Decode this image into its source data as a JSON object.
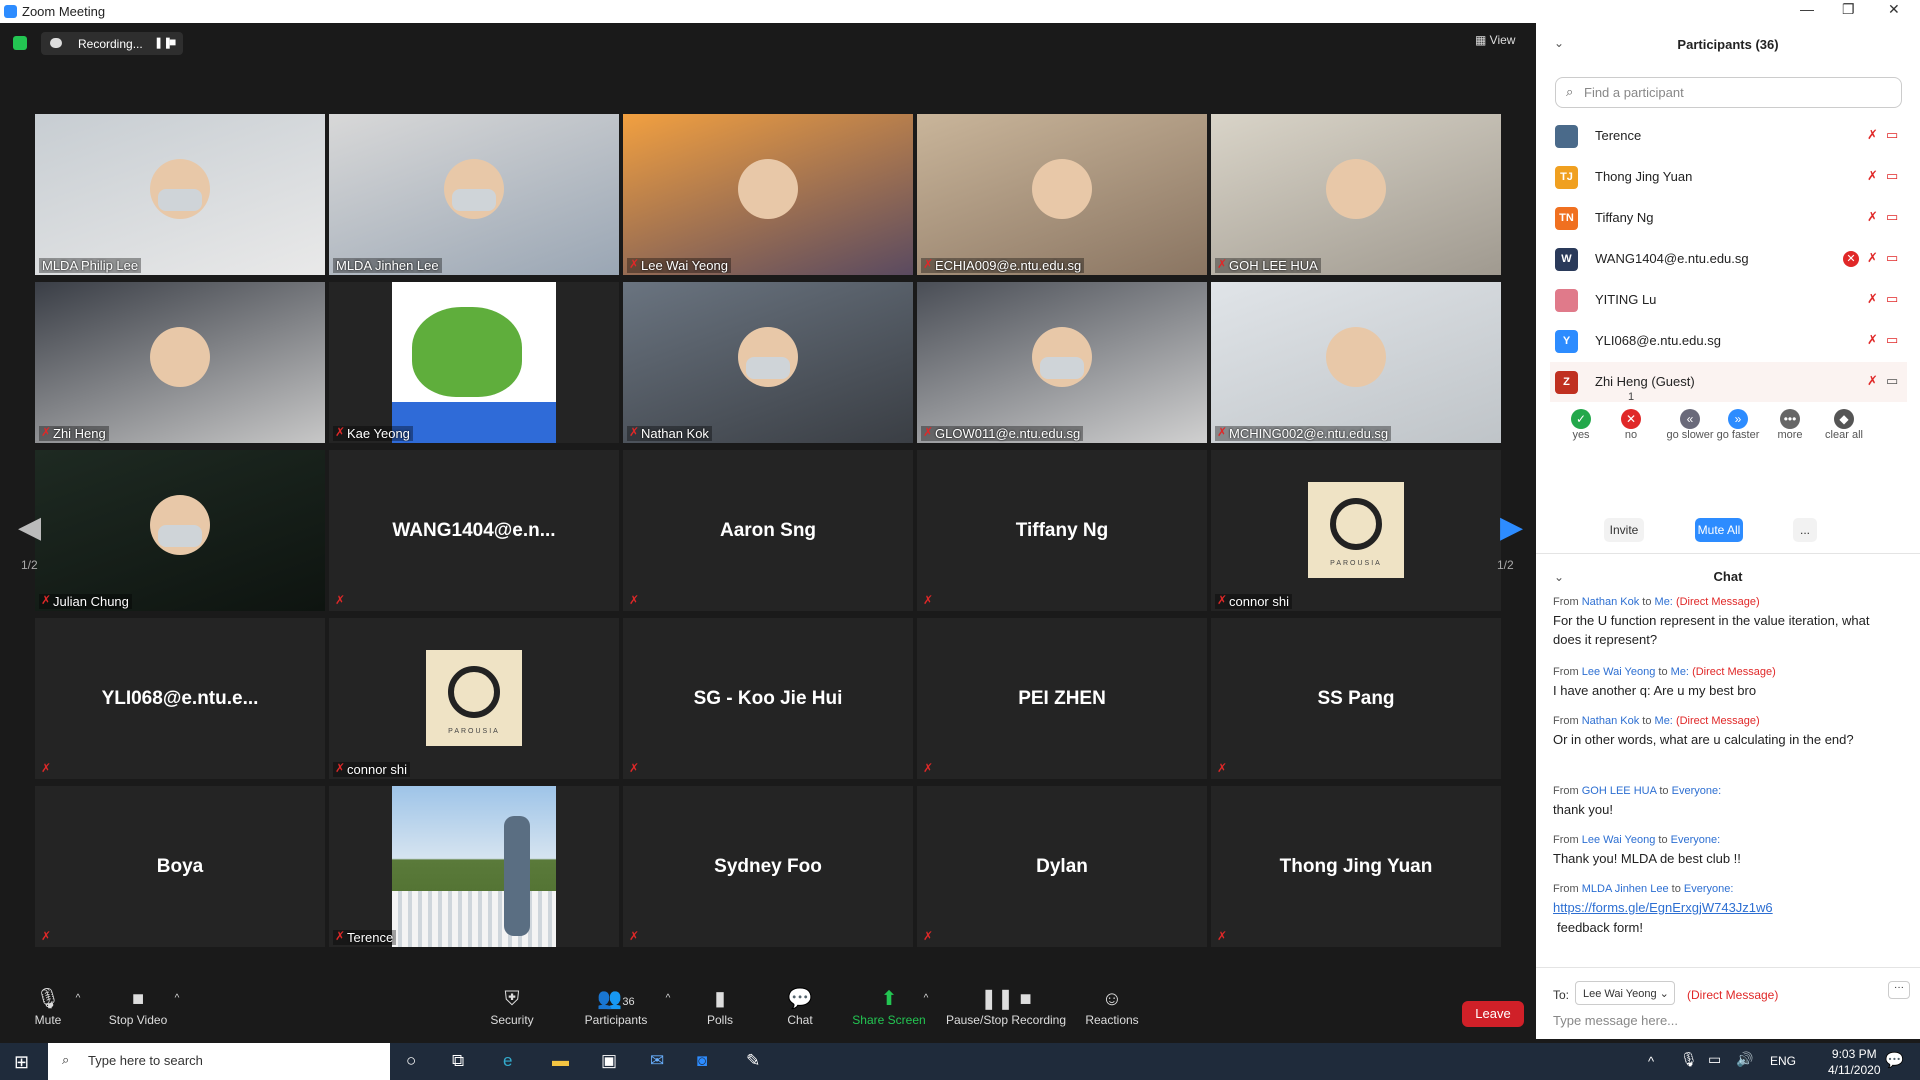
{
  "window": {
    "title": "Zoom Meeting"
  },
  "topbar": {
    "recording": "Recording...",
    "view": "View"
  },
  "page": {
    "left": "1/2",
    "right": "1/2"
  },
  "tiles": [
    {
      "name": "MLDA Philip Lee",
      "video": true
    },
    {
      "name": "MLDA Jinhen Lee",
      "video": true,
      "active": true
    },
    {
      "name": "Lee Wai Yeong",
      "video": true
    },
    {
      "name": "ECHIA009@e.ntu.edu.sg",
      "video": true
    },
    {
      "name": "GOH LEE HUA",
      "video": true
    },
    {
      "name": "Zhi Heng",
      "video": true
    },
    {
      "name": "Kae Yeong",
      "video": true
    },
    {
      "name": "Nathan Kok",
      "video": true
    },
    {
      "name": "GLOW011@e.ntu.edu.sg",
      "video": true
    },
    {
      "name": "MCHING002@e.ntu.edu.sg",
      "video": true
    },
    {
      "name": "Julian Chung",
      "video": true
    },
    {
      "name": "WANG1404@e.n...",
      "video": false
    },
    {
      "name": "Aaron Sng",
      "video": false
    },
    {
      "name": "Tiffany Ng",
      "video": false
    },
    {
      "name": "connor shi",
      "video": false,
      "logo": true
    },
    {
      "name": "YLI068@e.ntu.e...",
      "video": false
    },
    {
      "name": "connor shi",
      "video": false,
      "logo": true
    },
    {
      "name": "SG - Koo Jie Hui",
      "video": false
    },
    {
      "name": "PEI ZHEN",
      "video": false
    },
    {
      "name": "SS Pang",
      "video": false
    },
    {
      "name": "Boya",
      "video": false
    },
    {
      "name": "Terence",
      "video": true
    },
    {
      "name": "Sydney Foo",
      "video": false
    },
    {
      "name": "Dylan",
      "video": false
    },
    {
      "name": "Thong Jing Yuan",
      "video": false
    }
  ],
  "logo_text": "PAROUSIA",
  "toolbar": {
    "mute": "Mute",
    "stop_video": "Stop Video",
    "security": "Security",
    "participants": "Participants",
    "participants_count": "36",
    "polls": "Polls",
    "chat": "Chat",
    "share_screen": "Share Screen",
    "pause_stop_recording": "Pause/Stop Recording",
    "reactions": "Reactions",
    "leave": "Leave"
  },
  "participants": {
    "title": "Participants (36)",
    "search_placeholder": "Find a participant",
    "list": [
      {
        "name": "Terence",
        "initials": "",
        "color": "#4a6a8a"
      },
      {
        "name": "Thong Jing Yuan",
        "initials": "TJ",
        "color": "#f0a020"
      },
      {
        "name": "Tiffany Ng",
        "initials": "TN",
        "color": "#f07020"
      },
      {
        "name": "WANG1404@e.ntu.edu.sg",
        "initials": "W",
        "color": "#2a3a5a",
        "no": true
      },
      {
        "name": "YITING Lu",
        "initials": "",
        "color": "#e07a8a"
      },
      {
        "name": "YLI068@e.ntu.edu.sg",
        "initials": "Y",
        "color": "#2d8cff"
      },
      {
        "name": "Zhi Heng (Guest)",
        "initials": "Z",
        "color": "#c03020",
        "highlight": true,
        "video_on": true
      }
    ],
    "feedback": [
      {
        "label": "yes",
        "color": "#23a84b",
        "glyph": "✓",
        "count": ""
      },
      {
        "label": "no",
        "color": "#e02828",
        "glyph": "✕",
        "count": "1"
      },
      {
        "label": "go slower",
        "color": "#6a6a7a",
        "glyph": "«",
        "count": ""
      },
      {
        "label": "go faster",
        "color": "#2d8cff",
        "glyph": "»",
        "count": ""
      },
      {
        "label": "more",
        "color": "#666",
        "glyph": "•••",
        "count": ""
      },
      {
        "label": "clear all",
        "color": "#555",
        "glyph": "◆",
        "count": ""
      }
    ],
    "invite": "Invite",
    "mute_all": "Mute All",
    "more": "..."
  },
  "chat": {
    "title": "Chat",
    "messages": [
      {
        "from": "Nathan Kok",
        "to": "Me:",
        "dm": "(Direct Message)",
        "text": "For the U function represent in the value iteration, what does it represent?"
      },
      {
        "from": "Lee Wai Yeong",
        "to": "Me:",
        "dm": "(Direct Message)",
        "text": "I have another q: Are u my best bro"
      },
      {
        "from": "Nathan Kok",
        "to": "Me:",
        "dm": "(Direct Message)",
        "text": "Or in other words, what are u calculating in the end?"
      },
      {
        "from": "GOH LEE HUA",
        "to": "Everyone:",
        "dm": "",
        "text": "thank you!"
      },
      {
        "from": "Lee Wai Yeong",
        "to": "Everyone:",
        "dm": "",
        "text": "Thank you! MLDA de best club !!"
      },
      {
        "from": "MLDA Jinhen Lee",
        "to": "Everyone:",
        "dm": "",
        "text": "https://forms.gle/EgnErxgjW743Jz1w6",
        "link": true
      }
    ],
    "extra": "feedback form!",
    "to_label": "To:",
    "to_value": "Lee Wai Yeong",
    "to_dm": "(Direct Message)",
    "input_placeholder": "Type message here...",
    "from_word": "From",
    "to_word": "to"
  },
  "taskbar": {
    "search": "Type here to search",
    "lang": "ENG",
    "time": "9:03 PM",
    "date": "4/11/2020"
  }
}
